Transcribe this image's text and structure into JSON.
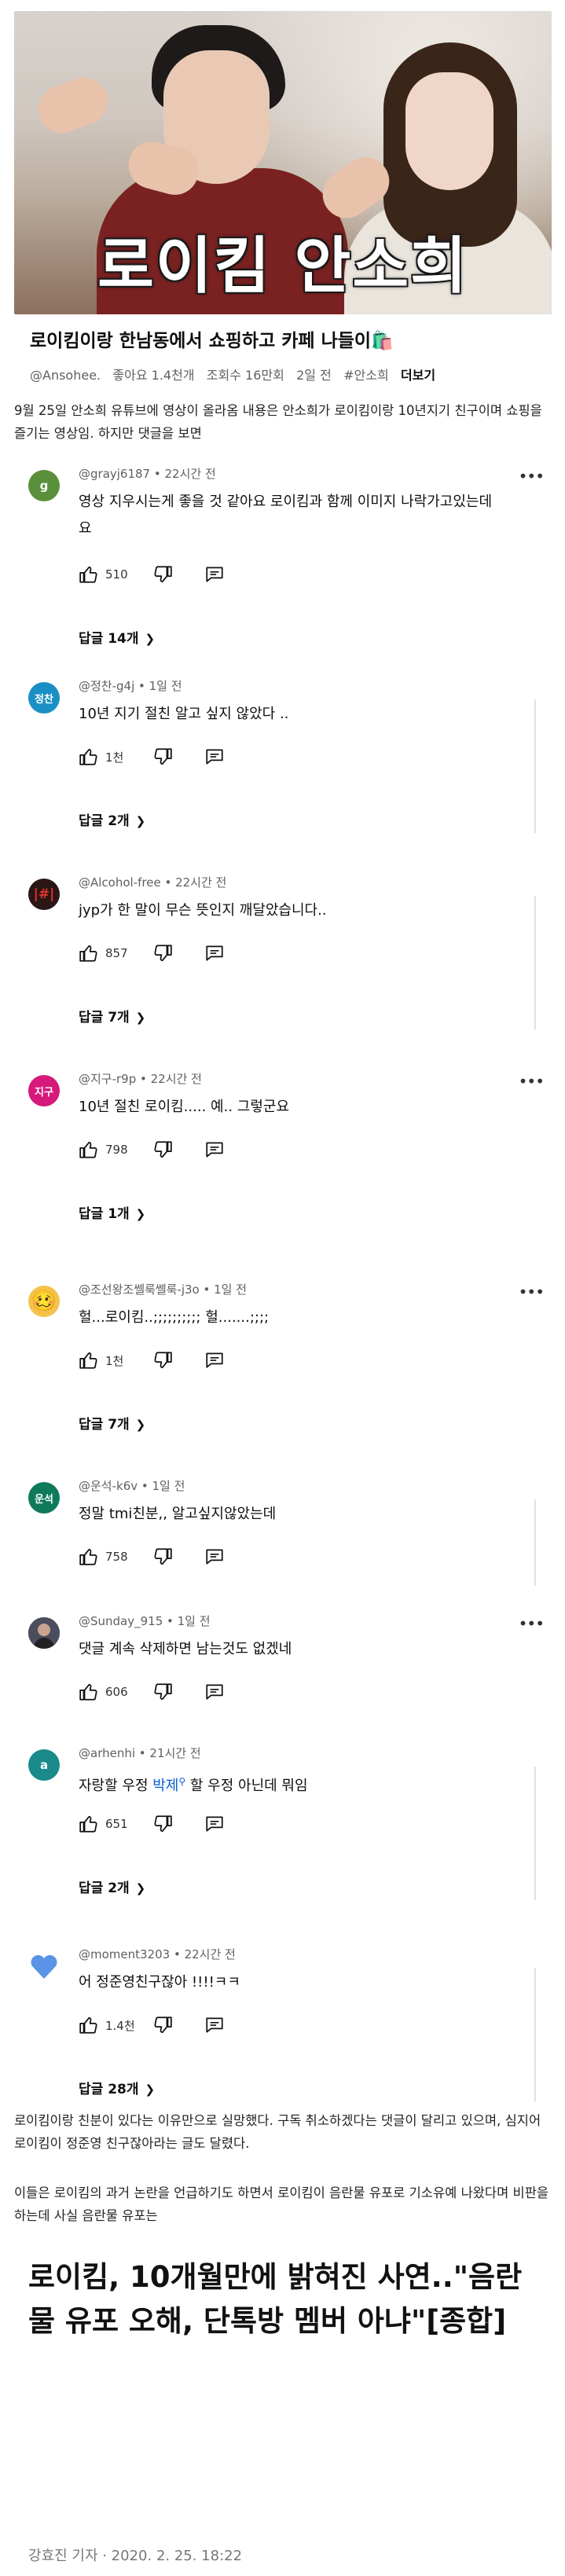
{
  "thumbnail": {
    "overlay_title": "로이킴 안소희"
  },
  "video": {
    "title": "로이킴이랑 한남동에서 쇼핑하고 카페 나들이🛍️",
    "channel": "@Ansohee.",
    "likes": "좋아요 1.4천개",
    "views": "조회수 16만회",
    "age": "2일 전",
    "hashtag": "#안소희",
    "more_label": "더보기"
  },
  "article": {
    "intro": "9월 25일 안소희 유튜브에 영상이 올라옴 내용은 안소희가 로이킴이랑 10년지기 친구이며 쇼핑을 즐기는 영상임. 하지만 댓글을 보면",
    "para1": "로이킴이랑 친분이 있다는 이유만으로 실망했다. 구독 취소하겠다는 댓글이 달리고 있으며, 심지어 로이킴이 정준영 친구잖아라는 글도 달렸다.",
    "para2": "이들은 로이킴의 과거 논란을 언급하기도 하면서 로이킴이 음란물 유포로 기소유예 나왔다며 비판을 하는데 사실 음란물 유포는"
  },
  "comments": [
    {
      "avatar_text": "g",
      "avatar_color": "#5a8f3c",
      "author": "@grayj6187 • 22시간 전",
      "text": "영상 지우시는게 좋을 것 같아요 로이킴과 함께 이미지 나락가고있는데요",
      "likes": "510",
      "replies": "답글 14개"
    },
    {
      "avatar_text": "정찬",
      "avatar_color": "#1a8fc4",
      "author": "@정찬-g4j • 1일 전",
      "text": "10년 지기 절친 알고 싶지 않았다  ..",
      "likes": "1천",
      "replies": "답글 2개"
    },
    {
      "avatar_text": "",
      "avatar_color": "#2b1616",
      "author": "@Alcohol-free • 22시간 전",
      "text": "jyp가 한 말이 무슨 뜻인지 깨달았습니다..",
      "likes": "857",
      "replies": "답글 7개"
    },
    {
      "avatar_text": "지구",
      "avatar_color": "#d6197a",
      "author": "@지구-r9p • 22시간 전",
      "text": "10년 절친 로이킴..... 예.. 그렇군요",
      "likes": "798",
      "replies": "답글 1개"
    },
    {
      "avatar_text": "",
      "avatar_color": "#f4c24a",
      "author": "@조선왕조쎌룩쎌룩-j3o • 1일 전",
      "text": "헐...로이킴..;;;;;;;;;; 헐.......;;;;",
      "likes": "1천",
      "replies": "답글 7개"
    },
    {
      "avatar_text": "운석",
      "avatar_color": "#0e7a5a",
      "author": "@운석-k6v • 1일 전",
      "text": "정말 tmi친분,, 알고싶지않았는데",
      "likes": "758",
      "replies": ""
    },
    {
      "avatar_text": "",
      "avatar_color": "#3d3f4a",
      "author": "@Sunday_915 • 1일 전",
      "text": "댓글 계속 삭제하면 남는것도 없겠네",
      "likes": "606",
      "replies": ""
    },
    {
      "avatar_text": "a",
      "avatar_color": "#1b8a8a",
      "author": "@arhenhi • 21시간 전",
      "text_before": "자랑할 우정 ",
      "keyword": "박제",
      "text_after": " 할 우정 아닌데 뭐임",
      "likes": "651",
      "replies": "답글 2개"
    },
    {
      "avatar_text": "",
      "avatar_color": "#6a9fe0",
      "author": "@moment3203 • 22시간 전",
      "text": "어 정준영친구잖아 !!!!ㅋㅋ",
      "likes": "1.4천",
      "replies": "답글 28개"
    }
  ],
  "news": {
    "headline": "로이킴, 10개월만에 밝혀진 사연..\"음란물 유포 오해, 단톡방 멤버 아냐\"[종합]",
    "byline": "강효진 기자 · 2020. 2. 25. 18:22"
  }
}
